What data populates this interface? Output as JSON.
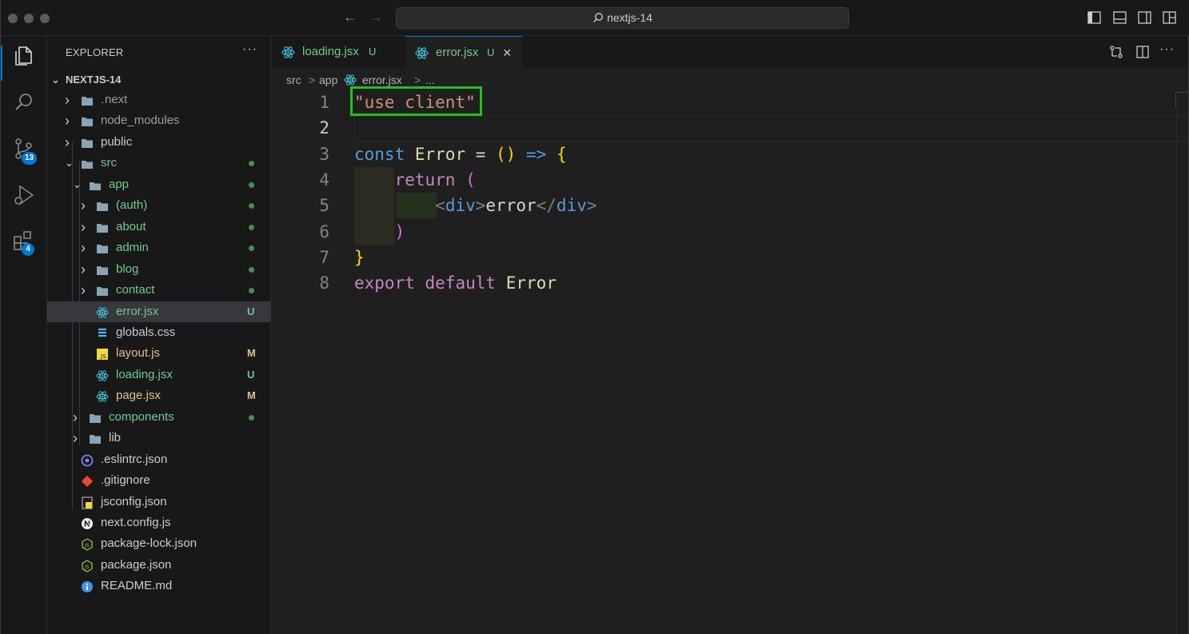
{
  "window": {
    "command_center": "nextjs-14"
  },
  "activity_bar": {
    "items": [
      {
        "icon": "files-icon",
        "active": true
      },
      {
        "icon": "search-icon"
      },
      {
        "icon": "source-control-icon",
        "badge": "13"
      },
      {
        "icon": "run-debug-icon"
      },
      {
        "icon": "extensions-icon",
        "badge": "4"
      }
    ]
  },
  "sidebar": {
    "title": "EXPLORER",
    "more": "···",
    "project": "NEXTJS-14",
    "tree": [
      {
        "label": "next",
        "prefix": ".",
        "type": "folder",
        "depth": 1,
        "expanded": false,
        "color": "#cccccc",
        "dim": true
      },
      {
        "label": "node_modules",
        "type": "folder",
        "depth": 1,
        "expanded": false,
        "color": "#9d9d9d"
      },
      {
        "label": "public",
        "type": "folder",
        "depth": 1,
        "expanded": false,
        "color": "#cccccc"
      },
      {
        "label": "src",
        "type": "folder",
        "depth": 1,
        "expanded": true,
        "color": "#73c991",
        "dot": true
      },
      {
        "label": "app",
        "type": "folder",
        "depth": 2,
        "expanded": true,
        "color": "#73c991",
        "dot": true
      },
      {
        "label": "(auth)",
        "type": "folder",
        "depth": 3,
        "expanded": false,
        "color": "#73c991",
        "dot": true
      },
      {
        "label": "about",
        "type": "folder",
        "depth": 3,
        "expanded": false,
        "color": "#73c991",
        "dot": true
      },
      {
        "label": "admin",
        "type": "folder",
        "depth": 3,
        "expanded": false,
        "color": "#73c991",
        "dot": true
      },
      {
        "label": "blog",
        "type": "folder",
        "depth": 3,
        "expanded": false,
        "color": "#73c991",
        "dot": true
      },
      {
        "label": "contact",
        "type": "folder",
        "depth": 3,
        "expanded": false,
        "color": "#73c991",
        "dot": true
      },
      {
        "label": "error.jsx",
        "type": "react",
        "depth": 3,
        "color": "#73c991",
        "status": "U",
        "selected": true
      },
      {
        "label": "globals.css",
        "type": "css",
        "depth": 3,
        "color": "#cccccc"
      },
      {
        "label": "layout.js",
        "type": "js",
        "depth": 3,
        "color": "#e2c08d",
        "status": "M"
      },
      {
        "label": "loading.jsx",
        "type": "react",
        "depth": 3,
        "color": "#73c991",
        "status": "U"
      },
      {
        "label": "page.jsx",
        "type": "react",
        "depth": 3,
        "color": "#e2c08d",
        "status": "M"
      },
      {
        "label": "components",
        "type": "folder",
        "depth": 2,
        "expanded": false,
        "color": "#73c991",
        "dot": true
      },
      {
        "label": "lib",
        "type": "folder",
        "depth": 2,
        "expanded": false,
        "color": "#cccccc"
      },
      {
        "label": ".eslintrc.json",
        "type": "eslint",
        "depth": 1,
        "color": "#cccccc"
      },
      {
        "label": ".gitignore",
        "type": "git",
        "depth": 1,
        "color": "#cccccc"
      },
      {
        "label": "jsconfig.json",
        "type": "jsconfig",
        "depth": 1,
        "color": "#cccccc"
      },
      {
        "label": "next.config.js",
        "type": "next",
        "depth": 1,
        "color": "#cccccc"
      },
      {
        "label": "package-lock.json",
        "type": "npm",
        "depth": 1,
        "color": "#cccccc"
      },
      {
        "label": "package.json",
        "type": "npm",
        "depth": 1,
        "color": "#cccccc"
      },
      {
        "label": "README.md",
        "type": "info",
        "depth": 1,
        "color": "#cccccc"
      }
    ]
  },
  "editor": {
    "tabs": [
      {
        "label": "loading.jsx",
        "status": "U",
        "active": false
      },
      {
        "label": "error.jsx",
        "status": "U",
        "active": true,
        "close": "×"
      }
    ],
    "breadcrumb": [
      "src",
      ">",
      "app",
      ">",
      "error.jsx",
      ">",
      "..."
    ],
    "line_numbers": [
      "1",
      "2",
      "3",
      "4",
      "5",
      "6",
      "7",
      "8"
    ],
    "lines": [
      [
        {
          "t": "\"use client\"",
          "c": "str"
        }
      ],
      [],
      [
        {
          "t": "const",
          "c": "kw"
        },
        {
          "t": " ",
          "c": "txt"
        },
        {
          "t": "Error",
          "c": "id"
        },
        {
          "t": " = ",
          "c": "op"
        },
        {
          "t": "()",
          "c": "br1"
        },
        {
          "t": " ",
          "c": "op"
        },
        {
          "t": "=>",
          "c": "kw"
        },
        {
          "t": " ",
          "c": "op"
        },
        {
          "t": "{",
          "c": "br1"
        }
      ],
      [
        {
          "t": "    ",
          "c": "txt"
        },
        {
          "t": "return",
          "c": "ctl"
        },
        {
          "t": " ",
          "c": "txt"
        },
        {
          "t": "(",
          "c": "br2"
        }
      ],
      [
        {
          "t": "        ",
          "c": "txt"
        },
        {
          "t": "<",
          "c": "tagb"
        },
        {
          "t": "div",
          "c": "tag"
        },
        {
          "t": ">",
          "c": "tagb"
        },
        {
          "t": "error",
          "c": "txt"
        },
        {
          "t": "</",
          "c": "tagb"
        },
        {
          "t": "div",
          "c": "tag"
        },
        {
          "t": ">",
          "c": "tagb"
        }
      ],
      [
        {
          "t": "    ",
          "c": "txt"
        },
        {
          "t": ")",
          "c": "br2"
        }
      ],
      [
        {
          "t": "}",
          "c": "br1"
        }
      ],
      [
        {
          "t": "export",
          "c": "ctl"
        },
        {
          "t": " ",
          "c": "txt"
        },
        {
          "t": "default",
          "c": "ctl"
        },
        {
          "t": " ",
          "c": "txt"
        },
        {
          "t": "Error",
          "c": "id"
        }
      ]
    ],
    "current_line": "2",
    "highlighted_text": "\"use client\""
  },
  "colors": {
    "accent": "#0078d4",
    "highlight_box": "#1ec21e",
    "untracked": "#73c991",
    "modified": "#e2c08d"
  }
}
